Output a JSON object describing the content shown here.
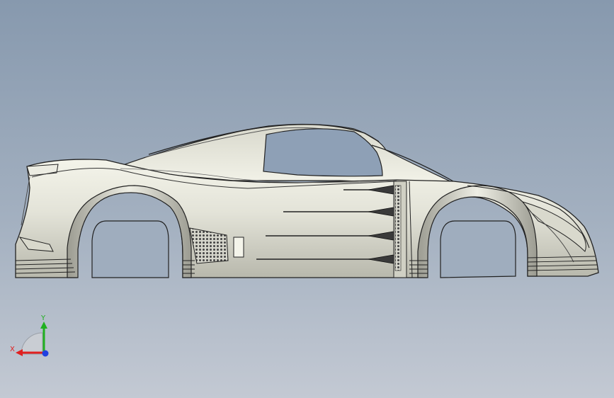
{
  "viewport": {
    "background_top": "#8799ae",
    "background_bottom": "#c3c9d3"
  },
  "model": {
    "name": "car-body-side-view",
    "body_color": "#e2e2d6",
    "line_color": "#202020",
    "glass_color": "#8ea0b6"
  },
  "triad": {
    "x_label": "X",
    "y_label": "Y",
    "x_color": "#e02020",
    "y_color": "#20b020",
    "z_color": "#2040e0"
  }
}
